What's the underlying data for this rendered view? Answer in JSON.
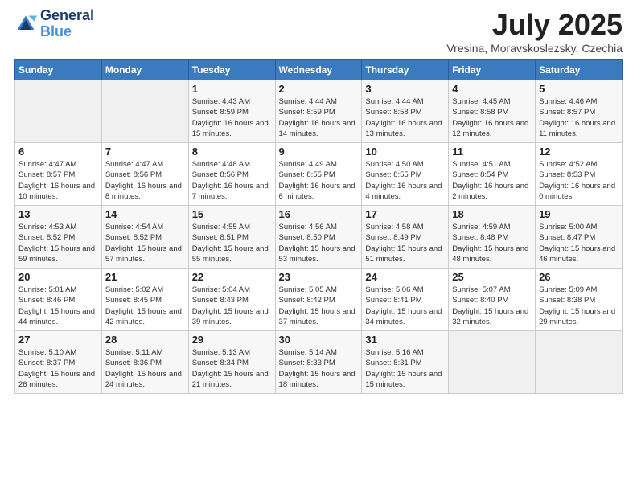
{
  "header": {
    "logo_line1": "General",
    "logo_line2": "Blue",
    "month_title": "July 2025",
    "location": "Vresina, Moravskoslezsky, Czechia"
  },
  "weekdays": [
    "Sunday",
    "Monday",
    "Tuesday",
    "Wednesday",
    "Thursday",
    "Friday",
    "Saturday"
  ],
  "weeks": [
    [
      {
        "day": "",
        "sunrise": "",
        "sunset": "",
        "daylight": ""
      },
      {
        "day": "",
        "sunrise": "",
        "sunset": "",
        "daylight": ""
      },
      {
        "day": "1",
        "sunrise": "Sunrise: 4:43 AM",
        "sunset": "Sunset: 8:59 PM",
        "daylight": "Daylight: 16 hours and 15 minutes."
      },
      {
        "day": "2",
        "sunrise": "Sunrise: 4:44 AM",
        "sunset": "Sunset: 8:59 PM",
        "daylight": "Daylight: 16 hours and 14 minutes."
      },
      {
        "day": "3",
        "sunrise": "Sunrise: 4:44 AM",
        "sunset": "Sunset: 8:58 PM",
        "daylight": "Daylight: 16 hours and 13 minutes."
      },
      {
        "day": "4",
        "sunrise": "Sunrise: 4:45 AM",
        "sunset": "Sunset: 8:58 PM",
        "daylight": "Daylight: 16 hours and 12 minutes."
      },
      {
        "day": "5",
        "sunrise": "Sunrise: 4:46 AM",
        "sunset": "Sunset: 8:57 PM",
        "daylight": "Daylight: 16 hours and 11 minutes."
      }
    ],
    [
      {
        "day": "6",
        "sunrise": "Sunrise: 4:47 AM",
        "sunset": "Sunset: 8:57 PM",
        "daylight": "Daylight: 16 hours and 10 minutes."
      },
      {
        "day": "7",
        "sunrise": "Sunrise: 4:47 AM",
        "sunset": "Sunset: 8:56 PM",
        "daylight": "Daylight: 16 hours and 8 minutes."
      },
      {
        "day": "8",
        "sunrise": "Sunrise: 4:48 AM",
        "sunset": "Sunset: 8:56 PM",
        "daylight": "Daylight: 16 hours and 7 minutes."
      },
      {
        "day": "9",
        "sunrise": "Sunrise: 4:49 AM",
        "sunset": "Sunset: 8:55 PM",
        "daylight": "Daylight: 16 hours and 6 minutes."
      },
      {
        "day": "10",
        "sunrise": "Sunrise: 4:50 AM",
        "sunset": "Sunset: 8:55 PM",
        "daylight": "Daylight: 16 hours and 4 minutes."
      },
      {
        "day": "11",
        "sunrise": "Sunrise: 4:51 AM",
        "sunset": "Sunset: 8:54 PM",
        "daylight": "Daylight: 16 hours and 2 minutes."
      },
      {
        "day": "12",
        "sunrise": "Sunrise: 4:52 AM",
        "sunset": "Sunset: 8:53 PM",
        "daylight": "Daylight: 16 hours and 0 minutes."
      }
    ],
    [
      {
        "day": "13",
        "sunrise": "Sunrise: 4:53 AM",
        "sunset": "Sunset: 8:52 PM",
        "daylight": "Daylight: 15 hours and 59 minutes."
      },
      {
        "day": "14",
        "sunrise": "Sunrise: 4:54 AM",
        "sunset": "Sunset: 8:52 PM",
        "daylight": "Daylight: 15 hours and 57 minutes."
      },
      {
        "day": "15",
        "sunrise": "Sunrise: 4:55 AM",
        "sunset": "Sunset: 8:51 PM",
        "daylight": "Daylight: 15 hours and 55 minutes."
      },
      {
        "day": "16",
        "sunrise": "Sunrise: 4:56 AM",
        "sunset": "Sunset: 8:50 PM",
        "daylight": "Daylight: 15 hours and 53 minutes."
      },
      {
        "day": "17",
        "sunrise": "Sunrise: 4:58 AM",
        "sunset": "Sunset: 8:49 PM",
        "daylight": "Daylight: 15 hours and 51 minutes."
      },
      {
        "day": "18",
        "sunrise": "Sunrise: 4:59 AM",
        "sunset": "Sunset: 8:48 PM",
        "daylight": "Daylight: 15 hours and 48 minutes."
      },
      {
        "day": "19",
        "sunrise": "Sunrise: 5:00 AM",
        "sunset": "Sunset: 8:47 PM",
        "daylight": "Daylight: 15 hours and 46 minutes."
      }
    ],
    [
      {
        "day": "20",
        "sunrise": "Sunrise: 5:01 AM",
        "sunset": "Sunset: 8:46 PM",
        "daylight": "Daylight: 15 hours and 44 minutes."
      },
      {
        "day": "21",
        "sunrise": "Sunrise: 5:02 AM",
        "sunset": "Sunset: 8:45 PM",
        "daylight": "Daylight: 15 hours and 42 minutes."
      },
      {
        "day": "22",
        "sunrise": "Sunrise: 5:04 AM",
        "sunset": "Sunset: 8:43 PM",
        "daylight": "Daylight: 15 hours and 39 minutes."
      },
      {
        "day": "23",
        "sunrise": "Sunrise: 5:05 AM",
        "sunset": "Sunset: 8:42 PM",
        "daylight": "Daylight: 15 hours and 37 minutes."
      },
      {
        "day": "24",
        "sunrise": "Sunrise: 5:06 AM",
        "sunset": "Sunset: 8:41 PM",
        "daylight": "Daylight: 15 hours and 34 minutes."
      },
      {
        "day": "25",
        "sunrise": "Sunrise: 5:07 AM",
        "sunset": "Sunset: 8:40 PM",
        "daylight": "Daylight: 15 hours and 32 minutes."
      },
      {
        "day": "26",
        "sunrise": "Sunrise: 5:09 AM",
        "sunset": "Sunset: 8:38 PM",
        "daylight": "Daylight: 15 hours and 29 minutes."
      }
    ],
    [
      {
        "day": "27",
        "sunrise": "Sunrise: 5:10 AM",
        "sunset": "Sunset: 8:37 PM",
        "daylight": "Daylight: 15 hours and 26 minutes."
      },
      {
        "day": "28",
        "sunrise": "Sunrise: 5:11 AM",
        "sunset": "Sunset: 8:36 PM",
        "daylight": "Daylight: 15 hours and 24 minutes."
      },
      {
        "day": "29",
        "sunrise": "Sunrise: 5:13 AM",
        "sunset": "Sunset: 8:34 PM",
        "daylight": "Daylight: 15 hours and 21 minutes."
      },
      {
        "day": "30",
        "sunrise": "Sunrise: 5:14 AM",
        "sunset": "Sunset: 8:33 PM",
        "daylight": "Daylight: 15 hours and 18 minutes."
      },
      {
        "day": "31",
        "sunrise": "Sunrise: 5:16 AM",
        "sunset": "Sunset: 8:31 PM",
        "daylight": "Daylight: 15 hours and 15 minutes."
      },
      {
        "day": "",
        "sunrise": "",
        "sunset": "",
        "daylight": ""
      },
      {
        "day": "",
        "sunrise": "",
        "sunset": "",
        "daylight": ""
      }
    ]
  ]
}
